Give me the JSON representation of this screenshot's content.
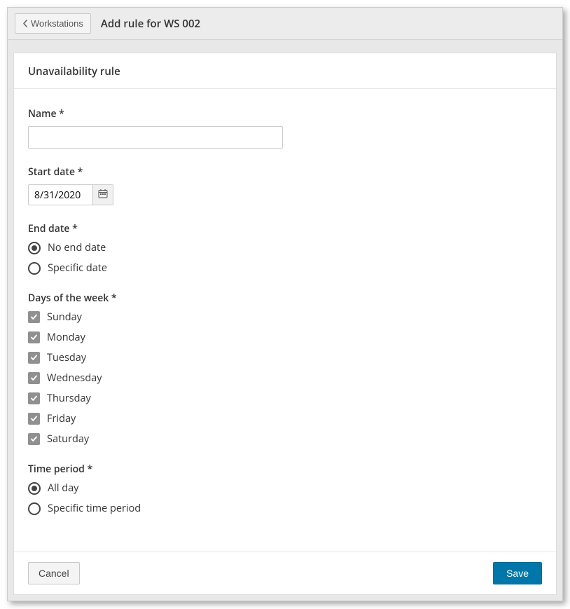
{
  "header": {
    "back_label": "Workstations",
    "page_title": "Add rule for WS 002"
  },
  "card": {
    "title": "Unavailability rule"
  },
  "form": {
    "name": {
      "label": "Name *",
      "value": ""
    },
    "start_date": {
      "label": "Start date *",
      "value": "8/31/2020"
    },
    "end_date": {
      "label": "End date *",
      "options": [
        {
          "label": "No end date",
          "checked": true
        },
        {
          "label": "Specific date",
          "checked": false
        }
      ]
    },
    "days": {
      "label": "Days of the week *",
      "items": [
        {
          "label": "Sunday",
          "checked": true
        },
        {
          "label": "Monday",
          "checked": true
        },
        {
          "label": "Tuesday",
          "checked": true
        },
        {
          "label": "Wednesday",
          "checked": true
        },
        {
          "label": "Thursday",
          "checked": true
        },
        {
          "label": "Friday",
          "checked": true
        },
        {
          "label": "Saturday",
          "checked": true
        }
      ]
    },
    "time_period": {
      "label": "Time period *",
      "options": [
        {
          "label": "All day",
          "checked": true
        },
        {
          "label": "Specific time period",
          "checked": false
        }
      ]
    }
  },
  "footer": {
    "cancel_label": "Cancel",
    "save_label": "Save"
  }
}
